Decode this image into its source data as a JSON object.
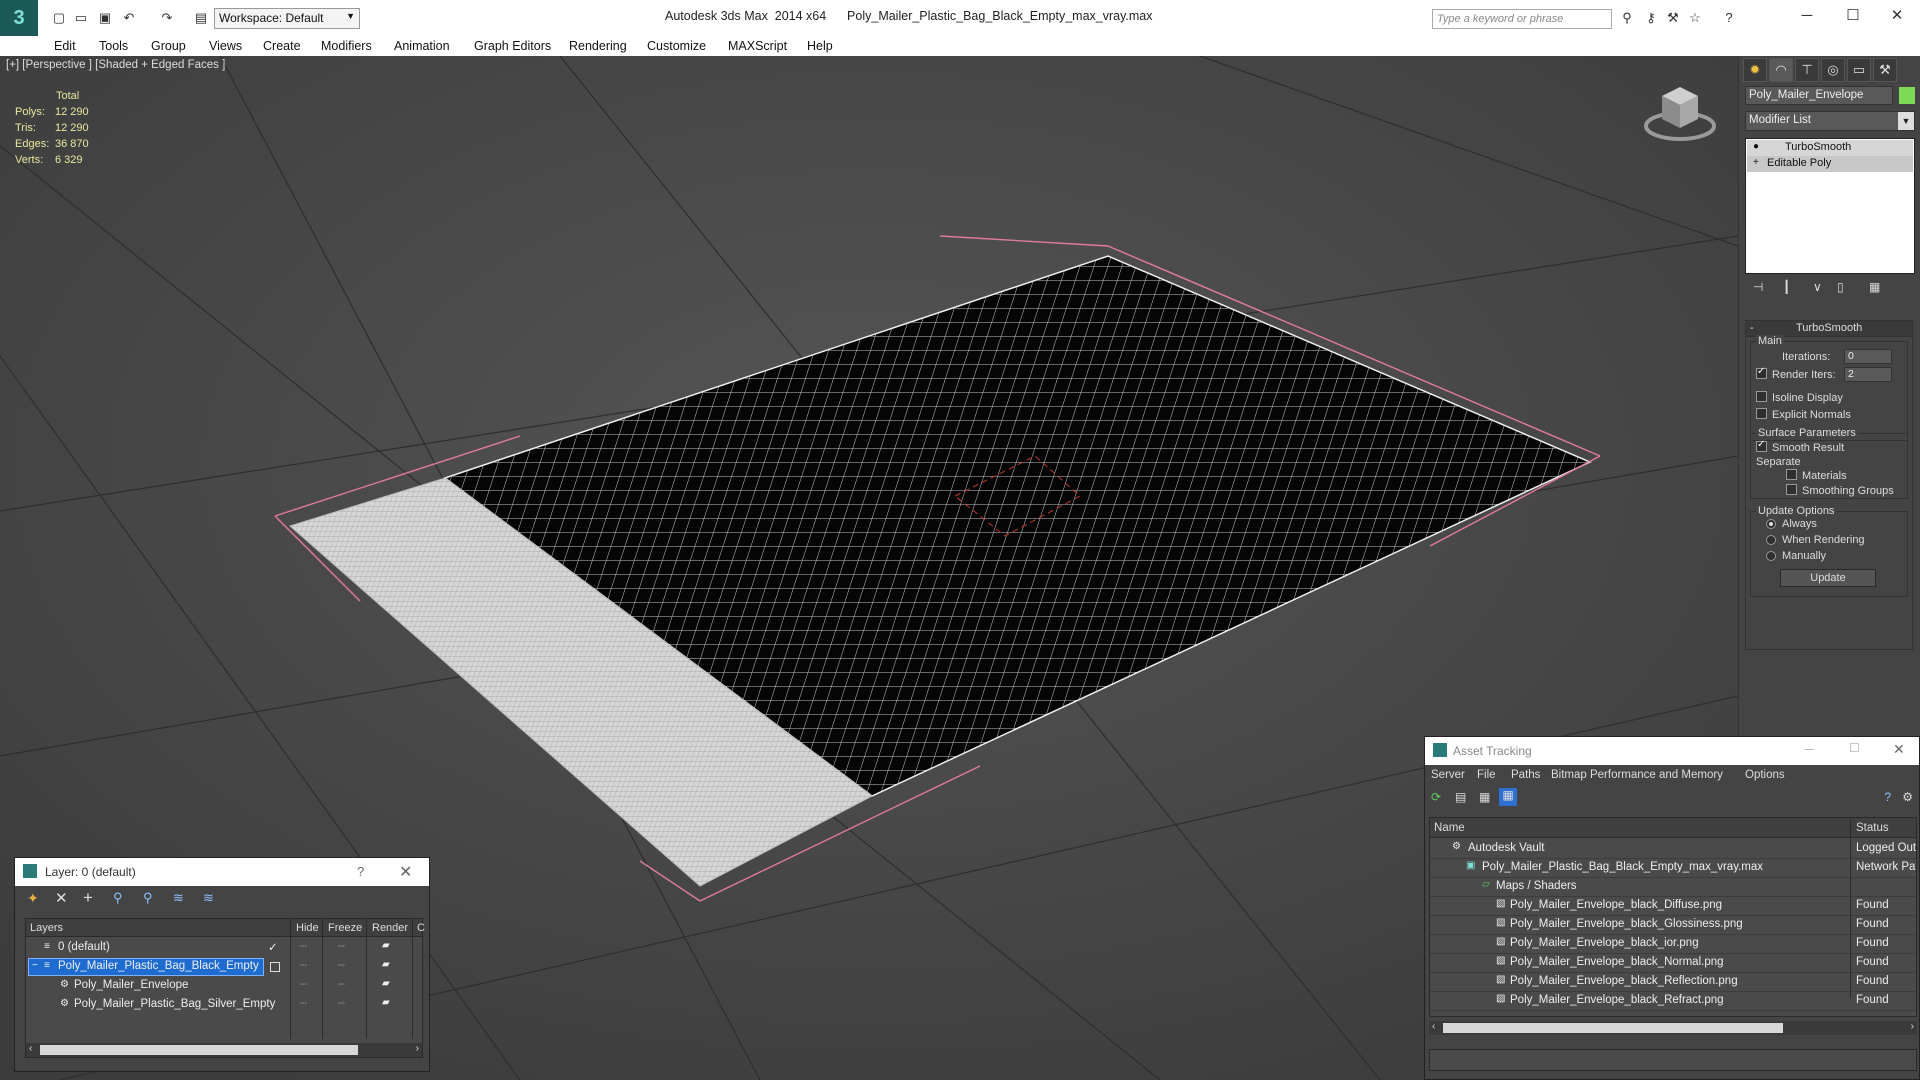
{
  "app": {
    "title": "Autodesk 3ds Max  2014 x64      Poly_Mailer_Plastic_Bag_Black_Empty_max_vray.max",
    "workspace": "Workspace: Default",
    "search_placeholder": "Type a keyword or phrase"
  },
  "menu": [
    "Edit",
    "Tools",
    "Group",
    "Views",
    "Create",
    "Modifiers",
    "Animation",
    "Graph Editors",
    "Rendering",
    "Customize",
    "MAXScript",
    "Help"
  ],
  "viewport": {
    "label": "[+] [Perspective ] [Shaded + Edged Faces ]",
    "stats": {
      "header": "Total",
      "rows": [
        {
          "label": "Polys:",
          "value": "12 290"
        },
        {
          "label": "Tris:",
          "value": "12 290"
        },
        {
          "label": "Edges:",
          "value": "36 870"
        },
        {
          "label": "Verts:",
          "value": "6 329"
        }
      ]
    }
  },
  "command_panel": {
    "object_name": "Poly_Mailer_Envelope",
    "object_color": "#7ed957",
    "modifier_list": "Modifier List",
    "stack": [
      "TurboSmooth",
      "Editable Poly"
    ],
    "turbosmooth": {
      "title": "TurboSmooth",
      "main": "Main",
      "iterations_label": "Iterations:",
      "iterations": "0",
      "render_iters_label": "Render Iters:",
      "render_iters": "2",
      "isoline": "Isoline Display",
      "explicit_normals": "Explicit Normals",
      "surface_params": "Surface Parameters",
      "smooth_result": "Smooth Result",
      "separate": "Separate",
      "materials": "Materials",
      "smoothing_groups": "Smoothing Groups",
      "update_options": "Update Options",
      "always": "Always",
      "when_rendering": "When Rendering",
      "manually": "Manually",
      "update_button": "Update"
    }
  },
  "layer_dialog": {
    "title": "Layer: 0 (default)",
    "help": "?",
    "columns": [
      "Layers",
      "Hide",
      "Freeze",
      "Render",
      "C"
    ],
    "rows": [
      {
        "name": "0 (default)",
        "indent": 1,
        "selected": false
      },
      {
        "name": "Poly_Mailer_Plastic_Bag_Black_Empty",
        "indent": 1,
        "selected": true
      },
      {
        "name": "Poly_Mailer_Envelope",
        "indent": 2,
        "selected": false
      },
      {
        "name": "Poly_Mailer_Plastic_Bag_Silver_Empty",
        "indent": 2,
        "selected": false
      }
    ]
  },
  "asset_dialog": {
    "title": "Asset Tracking",
    "menu": [
      "Server",
      "File",
      "Paths",
      "Bitmap Performance and Memory",
      "Options"
    ],
    "columns": [
      "Name",
      "Status"
    ],
    "rows": [
      {
        "name": "Autodesk Vault",
        "status": "Logged Out",
        "indent": 1
      },
      {
        "name": "Poly_Mailer_Plastic_Bag_Black_Empty_max_vray.max",
        "status": "Network Pat",
        "indent": 2
      },
      {
        "name": "Maps / Shaders",
        "status": "",
        "indent": 3
      },
      {
        "name": "Poly_Mailer_Envelope_black_Diffuse.png",
        "status": "Found",
        "indent": 4
      },
      {
        "name": "Poly_Mailer_Envelope_black_Glossiness.png",
        "status": "Found",
        "indent": 4
      },
      {
        "name": "Poly_Mailer_Envelope_black_ior.png",
        "status": "Found",
        "indent": 4
      },
      {
        "name": "Poly_Mailer_Envelope_black_Normal.png",
        "status": "Found",
        "indent": 4
      },
      {
        "name": "Poly_Mailer_Envelope_black_Reflection.png",
        "status": "Found",
        "indent": 4
      },
      {
        "name": "Poly_Mailer_Envelope_black_Refract.png",
        "status": "Found",
        "indent": 4
      }
    ]
  }
}
